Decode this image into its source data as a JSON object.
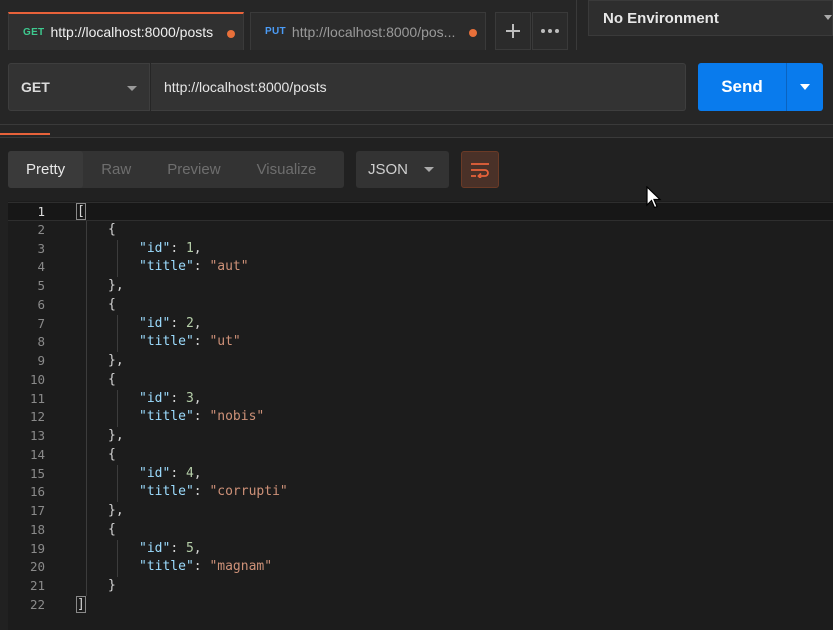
{
  "tabs": [
    {
      "method": "GET",
      "url": "http://localhost:8000/posts",
      "active": true
    },
    {
      "method": "PUT",
      "url": "http://localhost:8000/pos...",
      "active": false
    }
  ],
  "environment": {
    "label": "No Environment"
  },
  "request": {
    "method": "GET",
    "url": "http://localhost:8000/posts",
    "send_label": "Send"
  },
  "response": {
    "views": [
      "Pretty",
      "Raw",
      "Preview",
      "Visualize"
    ],
    "active_view": "Pretty",
    "format": "JSON"
  },
  "code_lines": [
    {
      "n": "1",
      "indent": 0,
      "tokens": [
        [
          "p",
          "["
        ]
      ]
    },
    {
      "n": "2",
      "indent": 1,
      "tokens": [
        [
          "p",
          "{"
        ]
      ]
    },
    {
      "n": "3",
      "indent": 2,
      "tokens": [
        [
          "k",
          "\"id\""
        ],
        [
          "p",
          ": "
        ],
        [
          "num",
          "1"
        ],
        [
          "p",
          ","
        ]
      ]
    },
    {
      "n": "4",
      "indent": 2,
      "tokens": [
        [
          "k",
          "\"title\""
        ],
        [
          "p",
          ": "
        ],
        [
          "str",
          "\"aut\""
        ]
      ]
    },
    {
      "n": "5",
      "indent": 1,
      "tokens": [
        [
          "p",
          "},"
        ]
      ]
    },
    {
      "n": "6",
      "indent": 1,
      "tokens": [
        [
          "p",
          "{"
        ]
      ]
    },
    {
      "n": "7",
      "indent": 2,
      "tokens": [
        [
          "k",
          "\"id\""
        ],
        [
          "p",
          ": "
        ],
        [
          "num",
          "2"
        ],
        [
          "p",
          ","
        ]
      ]
    },
    {
      "n": "8",
      "indent": 2,
      "tokens": [
        [
          "k",
          "\"title\""
        ],
        [
          "p",
          ": "
        ],
        [
          "str",
          "\"ut\""
        ]
      ]
    },
    {
      "n": "9",
      "indent": 1,
      "tokens": [
        [
          "p",
          "},"
        ]
      ]
    },
    {
      "n": "10",
      "indent": 1,
      "tokens": [
        [
          "p",
          "{"
        ]
      ]
    },
    {
      "n": "11",
      "indent": 2,
      "tokens": [
        [
          "k",
          "\"id\""
        ],
        [
          "p",
          ": "
        ],
        [
          "num",
          "3"
        ],
        [
          "p",
          ","
        ]
      ]
    },
    {
      "n": "12",
      "indent": 2,
      "tokens": [
        [
          "k",
          "\"title\""
        ],
        [
          "p",
          ": "
        ],
        [
          "str",
          "\"nobis\""
        ]
      ]
    },
    {
      "n": "13",
      "indent": 1,
      "tokens": [
        [
          "p",
          "},"
        ]
      ]
    },
    {
      "n": "14",
      "indent": 1,
      "tokens": [
        [
          "p",
          "{"
        ]
      ]
    },
    {
      "n": "15",
      "indent": 2,
      "tokens": [
        [
          "k",
          "\"id\""
        ],
        [
          "p",
          ": "
        ],
        [
          "num",
          "4"
        ],
        [
          "p",
          ","
        ]
      ]
    },
    {
      "n": "16",
      "indent": 2,
      "tokens": [
        [
          "k",
          "\"title\""
        ],
        [
          "p",
          ": "
        ],
        [
          "str",
          "\"corrupti\""
        ]
      ]
    },
    {
      "n": "17",
      "indent": 1,
      "tokens": [
        [
          "p",
          "},"
        ]
      ]
    },
    {
      "n": "18",
      "indent": 1,
      "tokens": [
        [
          "p",
          "{"
        ]
      ]
    },
    {
      "n": "19",
      "indent": 2,
      "tokens": [
        [
          "k",
          "\"id\""
        ],
        [
          "p",
          ": "
        ],
        [
          "num",
          "5"
        ],
        [
          "p",
          ","
        ]
      ]
    },
    {
      "n": "20",
      "indent": 2,
      "tokens": [
        [
          "k",
          "\"title\""
        ],
        [
          "p",
          ": "
        ],
        [
          "str",
          "\"magnam\""
        ]
      ]
    },
    {
      "n": "21",
      "indent": 1,
      "tokens": [
        [
          "p",
          "}"
        ]
      ]
    },
    {
      "n": "22",
      "indent": 0,
      "tokens": [
        [
          "p",
          "]"
        ]
      ]
    }
  ],
  "colors": {
    "accent_orange": "#e8623a",
    "send_blue": "#097bed",
    "method_get": "#3ec98f",
    "method_put": "#4b9cf7"
  }
}
